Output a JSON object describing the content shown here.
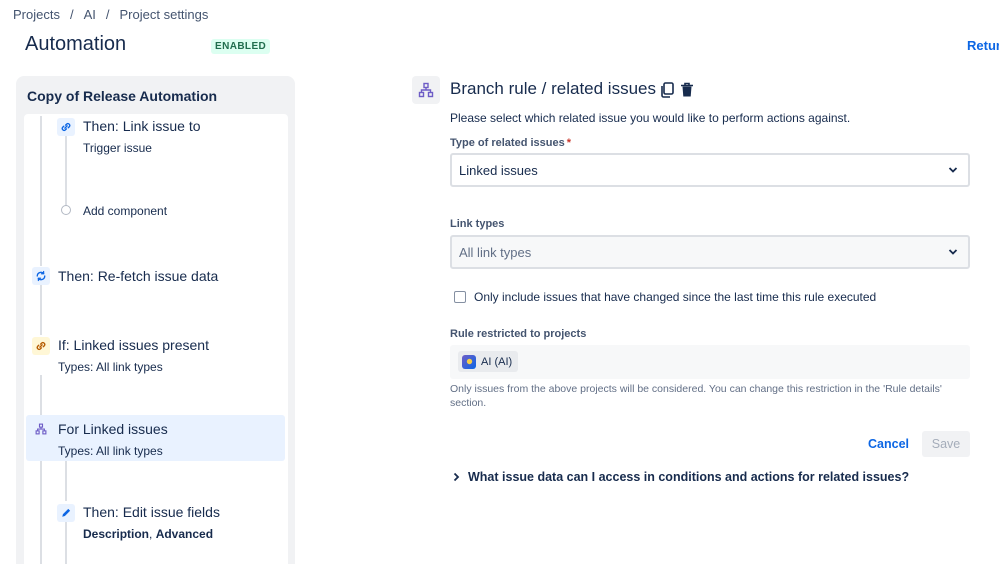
{
  "breadcrumb": {
    "projects": "Projects",
    "sep1": "/",
    "ai": "AI",
    "sep2": "/",
    "settings": "Project settings"
  },
  "header": {
    "title": "Automation",
    "status_badge": "ENABLED",
    "return_link": "Return"
  },
  "rule": {
    "name": "Copy of Release Automation",
    "nodes": {
      "link_issue": {
        "title": "Then: Link issue to",
        "sub": "Trigger issue",
        "icon": "link-icon"
      },
      "add_component": {
        "label": "Add component"
      },
      "refetch": {
        "title": "Then: Re-fetch issue data",
        "icon": "refresh-icon"
      },
      "if_linked": {
        "title": "If: Linked issues present",
        "sub": "Types: All link types",
        "icon": "link-icon"
      },
      "for_linked": {
        "title": "For Linked issues",
        "sub": "Types: All link types",
        "icon": "branch-icon"
      },
      "edit_fields": {
        "title": "Then: Edit issue fields",
        "sub_a": "Description",
        "sub_sep": ", ",
        "sub_b": "Advanced",
        "icon": "pencil-icon"
      }
    }
  },
  "branch": {
    "title": "Branch rule / related issues",
    "description": "Please select which related issue you would like to perform actions against.",
    "type_label": "Type of related issues",
    "required_mark": "*",
    "type_value": "Linked issues",
    "link_types_label": "Link types",
    "link_types_placeholder": "All link types",
    "checkbox_label": "Only include issues that have changed since the last time this rule executed",
    "restricted_label": "Rule restricted to projects",
    "project_chip": "AI (AI)",
    "helper_text": "Only issues from the above projects will be considered. You can change this restriction in the 'Rule details' section.",
    "cancel": "Cancel",
    "save": "Save",
    "faq": "What issue data can I access in conditions and actions for related issues?"
  },
  "colors": {
    "accent": "#0c66e4",
    "selected_bg": "#e9f2ff",
    "enabled_green": "#216e4e"
  }
}
